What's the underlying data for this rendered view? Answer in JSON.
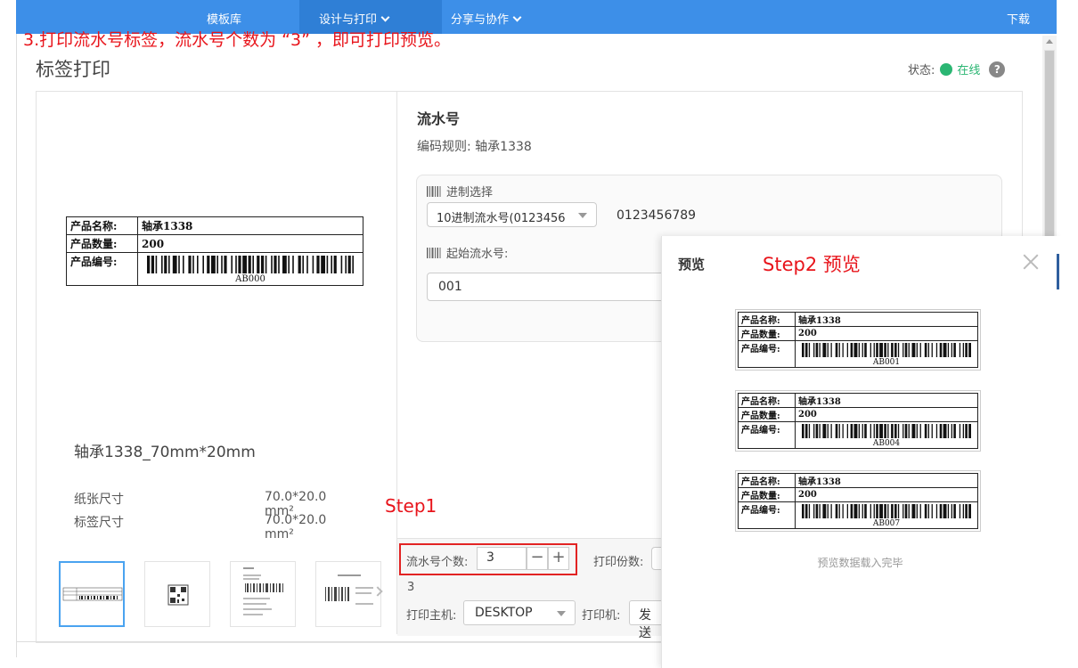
{
  "nav": {
    "items": [
      "模板库",
      "设计与打印",
      "分享与协作"
    ],
    "download": "下载"
  },
  "annotations": {
    "top": "3.打印流水号标签，流水号个数为 “3” ，即可打印预览。",
    "step1": "Step1",
    "step2": "Step2 预览"
  },
  "page": {
    "title": "标签打印",
    "status_label": "状态:",
    "status_value": "在线",
    "help": "?"
  },
  "label": {
    "rows": [
      {
        "key": "产品名称:",
        "value": "轴承1338"
      },
      {
        "key": "产品数量:",
        "value": "200"
      },
      {
        "key": "产品编号:",
        "value": ""
      }
    ],
    "code": "AB000"
  },
  "template": {
    "name": "轴承1338_70mm*20mm",
    "paper_size_label": "纸张尺寸",
    "paper_size_value": "70.0*20.0 mm²",
    "label_size_label": "标签尺寸",
    "label_size_value": "70.0*20.0 mm²"
  },
  "serial": {
    "title": "流水号",
    "rule": "编码规则: 轴承1338",
    "radix_label": "进制选择",
    "radix_selected": "10进制流水号(0123456",
    "radix_digits": "0123456789",
    "start_label": "起始流水号:",
    "start_value": "001"
  },
  "controls": {
    "count_label": "流水号个数:",
    "count_value": "3",
    "minus": "−",
    "plus": "+",
    "copies_label": "打印份数:",
    "count_echo": "3",
    "host_label": "打印主机:",
    "host_value": "DESKTOP",
    "printer_label": "打印机:",
    "send": "发送"
  },
  "preview": {
    "title": "预览",
    "labels": [
      {
        "name": "轴承1338",
        "qty": "200",
        "code": "AB001"
      },
      {
        "name": "轴承1338",
        "qty": "200",
        "code": "AB004"
      },
      {
        "name": "轴承1338",
        "qty": "200",
        "code": "AB007"
      }
    ],
    "key_name": "产品名称:",
    "key_qty": "产品数量:",
    "key_code": "产品编号:",
    "done": "预览数据载入完毕"
  },
  "colors": {
    "nav": "#3d8fe8",
    "annotation": "#e8141b",
    "online": "#2bb673",
    "selection": "#4aa3f0"
  }
}
